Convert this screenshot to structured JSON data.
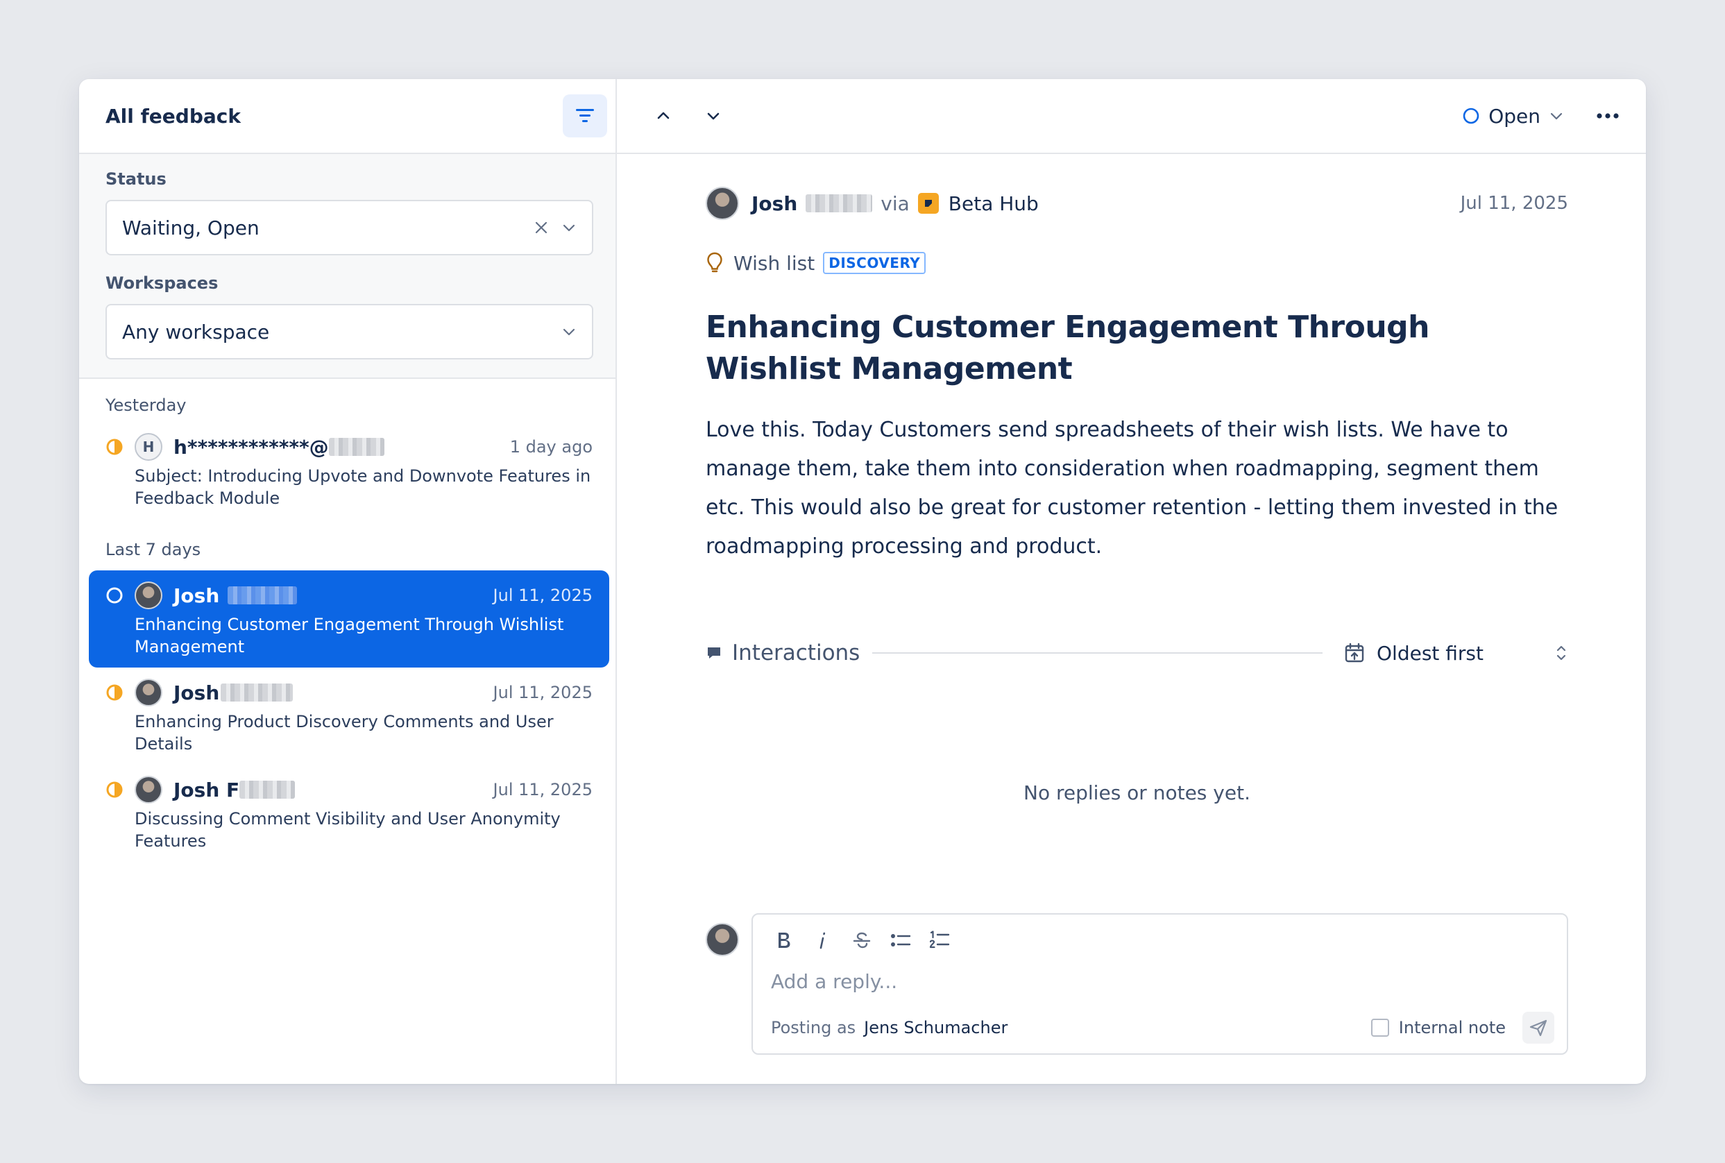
{
  "sidebar": {
    "title": "All feedback",
    "filters": {
      "status_label": "Status",
      "status_value": "Waiting, Open",
      "workspaces_label": "Workspaces",
      "workspaces_value": "Any workspace"
    },
    "groups": [
      {
        "label": "Yesterday",
        "items": [
          {
            "status": "waiting",
            "avatar_letter": "H",
            "name": "h************@",
            "date": "1 day ago",
            "subject": "Subject: Introducing Upvote and Downvote Features in Feedback Module"
          }
        ]
      },
      {
        "label": "Last 7 days",
        "items": [
          {
            "status": "open",
            "name": "Josh",
            "date": "Jul 11, 2025",
            "subject": "Enhancing Customer Engagement Through Wishlist Management",
            "selected": true
          },
          {
            "status": "waiting",
            "name": "Josh",
            "date": "Jul 11, 2025",
            "subject": "Enhancing Product Discovery Comments and User Details"
          },
          {
            "status": "waiting",
            "name": "Josh F",
            "date": "Jul 11, 2025",
            "subject": "Discussing Comment Visibility and User Anonymity Features"
          }
        ]
      }
    ]
  },
  "detail": {
    "status": "Open",
    "author": "Josh",
    "via": "via",
    "source": "Beta Hub",
    "date": "Jul 11, 2025",
    "category": "Wish list",
    "badge": "DISCOVERY",
    "title": "Enhancing Customer Engagement Through Wishlist Management",
    "body": "Love this. Today Customers send spreadsheets of their wish lists. We have to manage them, take them into consideration when roadmapping, segment them etc. This would also be great for customer retention - letting them invested in the roadmapping processing and product.",
    "interactions_label": "Interactions",
    "sort_label": "Oldest first",
    "empty_text": "No replies or notes yet."
  },
  "reply": {
    "placeholder": "Add a reply...",
    "posting_as_label": "Posting as",
    "posting_as_name": "Jens Schumacher",
    "internal_note_label": "Internal note"
  },
  "colors": {
    "accent": "#0c66e4",
    "waiting": "#f5a623",
    "source_icon": "#f5a623"
  }
}
